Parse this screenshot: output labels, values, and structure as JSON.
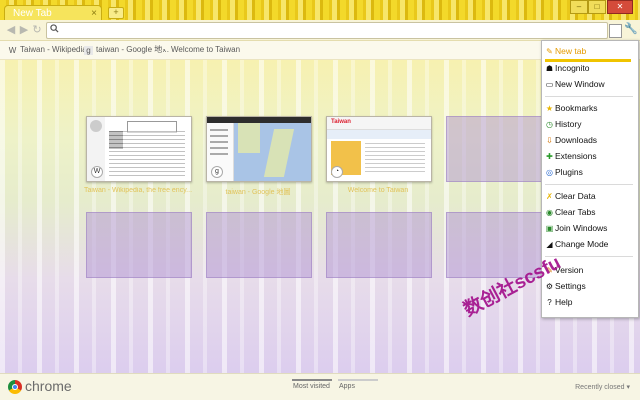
{
  "tab": {
    "title": "New Tab",
    "close": "×"
  },
  "window": {
    "min": "–",
    "max": "□",
    "close": "✕"
  },
  "toolbar": {
    "back": "◀",
    "forward": "▶",
    "reload": "↻",
    "omnibox_value": "",
    "search_icon": "search-icon"
  },
  "bookmarks": [
    {
      "icon": "W",
      "label": "Taiwan - Wikipedia..."
    },
    {
      "icon": "g",
      "label": "taiwan - Google 地..."
    },
    {
      "icon": "◔",
      "label": "Welcome to Taiwan"
    }
  ],
  "thumbnails": [
    {
      "title": "Taiwan - Wikipedia, the free ency..."
    },
    {
      "title": "taiwan - Google 地圖"
    },
    {
      "title": "Welcome to Taiwan"
    }
  ],
  "footer": {
    "brand": "chrome",
    "tabs": [
      {
        "label": "Most visited"
      },
      {
        "label": "Apps"
      }
    ],
    "recently_closed": "Recently closed ▾"
  },
  "menu": {
    "items": [
      {
        "icon": "✎",
        "label": "New tab",
        "highlight": true
      },
      {
        "icon": "☗",
        "label": "Incognito"
      },
      {
        "icon": "▭",
        "label": "New Window"
      },
      {
        "icon": "★",
        "label": "Bookmarks"
      },
      {
        "icon": "◷",
        "label": "History"
      },
      {
        "icon": "⇩",
        "label": "Downloads"
      },
      {
        "icon": "✚",
        "label": "Extensions"
      },
      {
        "icon": "◎",
        "label": "Plugins"
      },
      {
        "icon": "✗",
        "label": "Clear Data"
      },
      {
        "icon": "◉",
        "label": "Clear Tabs"
      },
      {
        "icon": "▣",
        "label": "Join Windows"
      },
      {
        "icon": "◢",
        "label": "Change Mode"
      },
      {
        "icon": "✎",
        "label": "Version"
      },
      {
        "icon": "⚙",
        "label": "Settings"
      },
      {
        "icon": "?",
        "label": "Help"
      }
    ]
  },
  "watermark": "数创社scsfu",
  "colors": {
    "accent": "#f0c400",
    "menu_highlight": "#e59b00",
    "watermark": "#a3118c"
  }
}
